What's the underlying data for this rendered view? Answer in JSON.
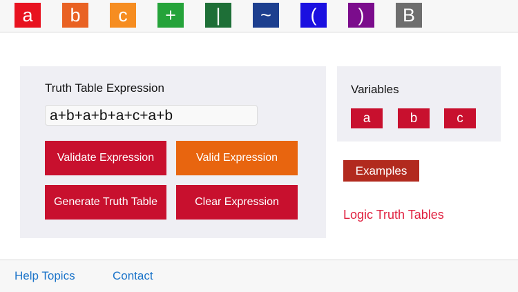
{
  "toolbar": {
    "keys": [
      {
        "label": "a",
        "color": "#e8121f"
      },
      {
        "label": "b",
        "color": "#e96223"
      },
      {
        "label": "c",
        "color": "#f68d21"
      },
      {
        "label": "+",
        "color": "#25a33a"
      },
      {
        "label": "|",
        "color": "#1e6f37"
      },
      {
        "label": "~",
        "color": "#1d3f8f"
      },
      {
        "label": "(",
        "color": "#1a10e0"
      },
      {
        "label": ")",
        "color": "#7b0c8c"
      },
      {
        "label": "B",
        "color": "#6e6e6e"
      }
    ]
  },
  "main": {
    "expression_label": "Truth Table Expression",
    "expression_value": "a+b+a+b+a+c+a+b",
    "buttons": {
      "validate": "Validate Expression",
      "valid": "Valid Expression",
      "generate": "Generate Truth Table",
      "clear": "Clear Expression"
    },
    "colors": {
      "primary": "#c8102e",
      "status": "#e8650f"
    }
  },
  "variables": {
    "title": "Variables",
    "items": [
      "a",
      "b",
      "c"
    ]
  },
  "examples_label": "Examples",
  "app_link": "Logic Truth Tables",
  "footer": {
    "help": "Help Topics",
    "contact": "Contact"
  }
}
